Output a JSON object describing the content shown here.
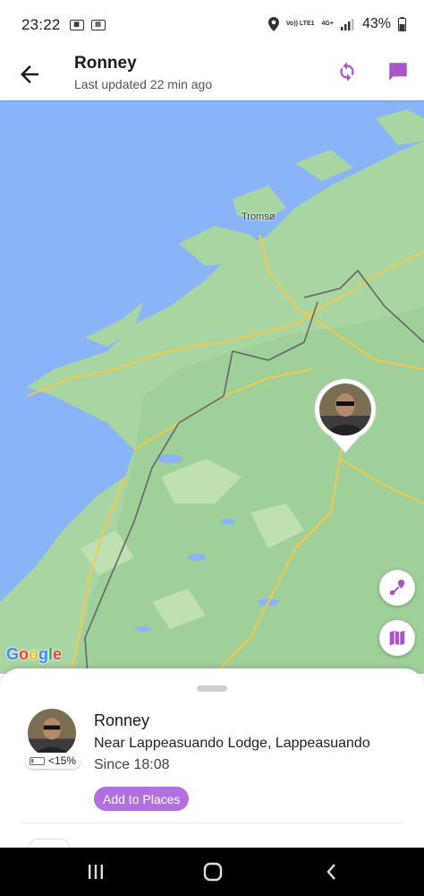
{
  "status_bar": {
    "time": "23:22",
    "network_top": "Vo)) LTE1",
    "network_type": "4G+",
    "battery": "43%"
  },
  "header": {
    "title": "Ronney",
    "subtitle": "Last updated 22 min ago",
    "icons": [
      "back-arrow-icon",
      "refresh-icon",
      "chat-icon"
    ],
    "accent_color": "#a855c7"
  },
  "map": {
    "place_label": "Tromsø",
    "attribution": "Google",
    "buttons": [
      "route-icon",
      "map-icon"
    ]
  },
  "person": {
    "name": "Ronney",
    "location": "Near Lappeasuando Lodge, Lappeasuando",
    "since": "Since 18:08",
    "battery_label": "<15%",
    "add_places_label": "Add to Places"
  },
  "nav": {
    "buttons": [
      "recents-icon",
      "home-icon",
      "back-icon"
    ]
  }
}
